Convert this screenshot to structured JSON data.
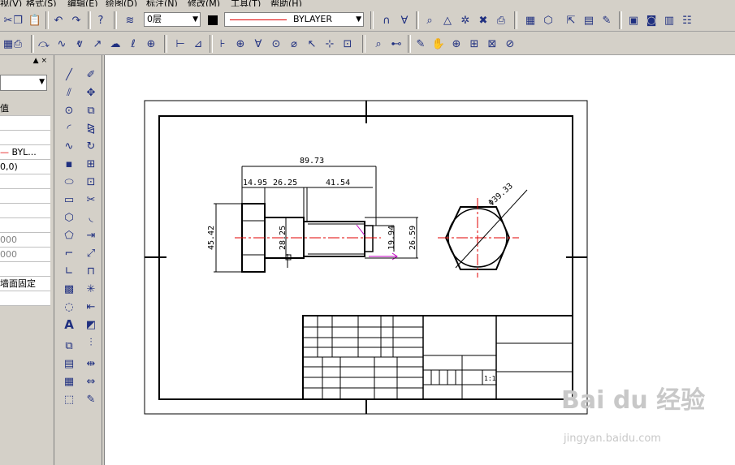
{
  "menu": {
    "items": [
      "视(V)",
      "格式(S)",
      "编辑(E)",
      "绘图(D)",
      "标注(N)",
      "修改(M)",
      "工具(T)",
      "帮助(H)"
    ]
  },
  "toolbar1": {
    "layer_value": "0层",
    "linetype_value": "BYLAYER"
  },
  "left_panel": {
    "header_value": "值",
    "rows": [
      "",
      "",
      "",
      "BYL...",
      "0,0)",
      "",
      "",
      "",
      "",
      "000",
      "000",
      "",
      "墙面固定",
      ""
    ]
  },
  "drawing": {
    "dims": {
      "overall": "89.73",
      "d1": "14.95",
      "d2": "26.25",
      "d3": "41.54",
      "height": "45.42",
      "shank": "28.25",
      "thread_small": "19.94",
      "thread_big": "26.59",
      "diameter": "Φ39.33"
    },
    "scale_label": "1:1"
  },
  "watermark": {
    "logo_text": "Bai du 经验",
    "url": "jingyan.baidu.com"
  },
  "colors": {
    "red": "#e00000",
    "magenta": "#c000c0",
    "panel": "#d4d0c8"
  }
}
